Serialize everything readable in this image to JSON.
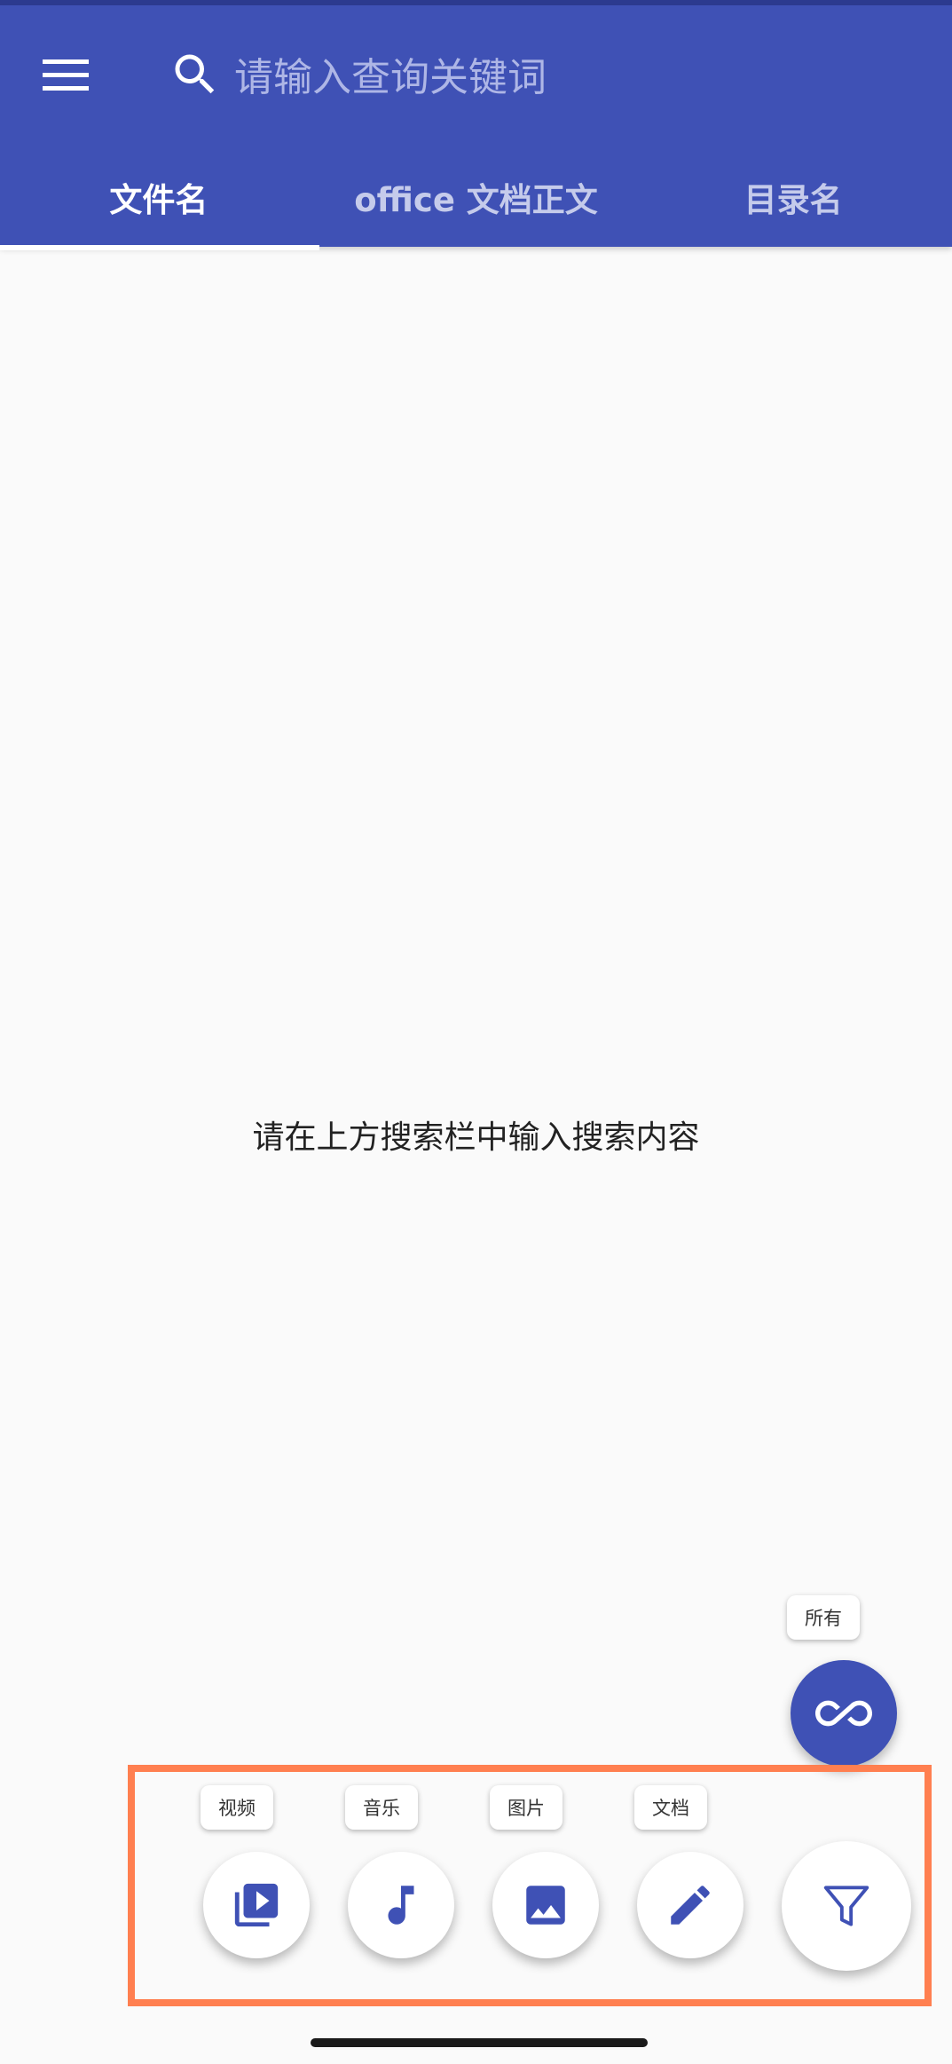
{
  "header": {
    "search_placeholder": "请输入查询关键词",
    "icons": {
      "menu": "menu-icon",
      "search": "search-icon"
    }
  },
  "tabs": [
    {
      "label": "文件名",
      "active": true
    },
    {
      "label": "office 文档正文",
      "active": false
    },
    {
      "label": "目录名",
      "active": false
    }
  ],
  "main": {
    "empty_message": "请在上方搜索栏中输入搜索内容"
  },
  "filters": {
    "all": {
      "label": "所有",
      "icon": "infinity-icon"
    },
    "video": {
      "label": "视频",
      "icon": "video-library-icon"
    },
    "music": {
      "label": "音乐",
      "icon": "music-note-icon"
    },
    "image": {
      "label": "图片",
      "icon": "image-icon"
    },
    "document": {
      "label": "文档",
      "icon": "pencil-icon"
    },
    "toggle": {
      "icon": "filter-icon"
    }
  },
  "colors": {
    "primary": "#3f51b5",
    "highlight": "#ff7f50",
    "background": "#fafafa"
  }
}
